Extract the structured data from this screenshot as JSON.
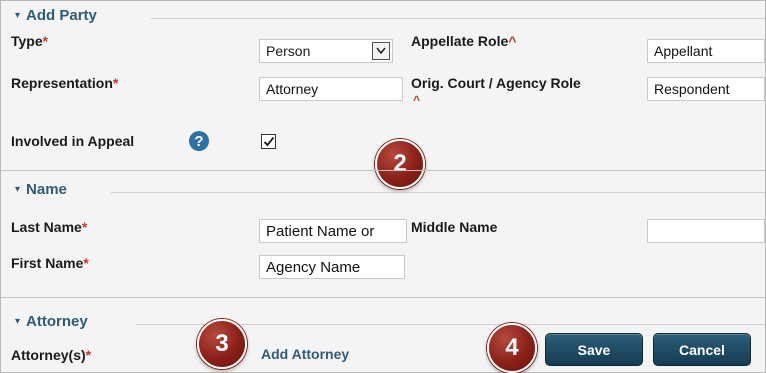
{
  "add_party": {
    "legend": "Add Party",
    "type_label": "Type",
    "type_value": "Person",
    "appellate_role_label": "Appellate Role",
    "appellate_role_value": "Appellant",
    "representation_label": "Representation",
    "representation_value": "Attorney",
    "orig_role_label": "Orig. Court / Agency Role",
    "orig_role_value": "Respondent",
    "involved_label": "Involved in Appeal",
    "involved_checked": true
  },
  "name": {
    "legend": "Name",
    "last_name_label": "Last Name",
    "last_name_value": "Patient Name or",
    "middle_name_label": "Middle Name",
    "middle_name_value": "",
    "first_name_label": "First Name",
    "first_name_value": "Agency Name"
  },
  "attorney": {
    "legend": "Attorney",
    "attorneys_label": "Attorney(s)",
    "add_attorney_link": "Add Attorney"
  },
  "actions": {
    "save_label": "Save",
    "cancel_label": "Cancel"
  },
  "callouts": {
    "badge_2": "2",
    "badge_3": "3",
    "badge_4": "4"
  },
  "glyphs": {
    "required_mark": "*",
    "required_mark_alt": "^",
    "help_icon": "?",
    "checkmark": "✓",
    "dropdown_arrow": "▾",
    "collapse_triangle": "▾"
  },
  "colors": {
    "section_title": "#2f5b76",
    "required": "#c0392b",
    "button_bg": "#1e4a63",
    "badge_bg": "#8a2018",
    "help_icon_bg": "#2f6fa6"
  }
}
